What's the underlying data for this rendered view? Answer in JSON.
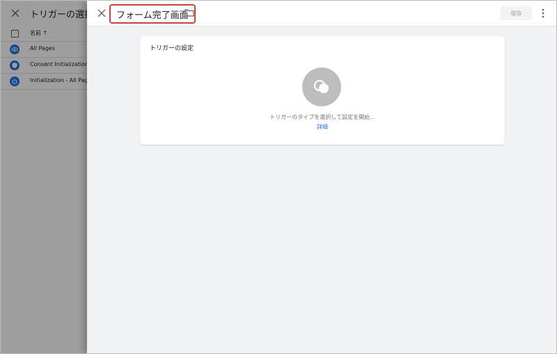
{
  "background_panel": {
    "title": "トリガーの選択",
    "column_header": "名前 ↑",
    "rows": [
      {
        "label": "All Pages",
        "icon": "eye-icon"
      },
      {
        "label": "Consent Initialization - All Pages",
        "icon": "shield-icon"
      },
      {
        "label": "Initialization - All Pages",
        "icon": "power-icon"
      }
    ]
  },
  "editor": {
    "title": "フォーム完了画面",
    "save_label": "保存",
    "card": {
      "title": "トリガーの設定",
      "hint": "トリガーのタイプを選択して設定を開始...",
      "detail_link": "詳細"
    }
  },
  "colors": {
    "accent": "#1a73e8",
    "highlight_border": "#e53935",
    "sheet_bg": "#f1f3f4",
    "scrim": "#9e9e9e"
  }
}
